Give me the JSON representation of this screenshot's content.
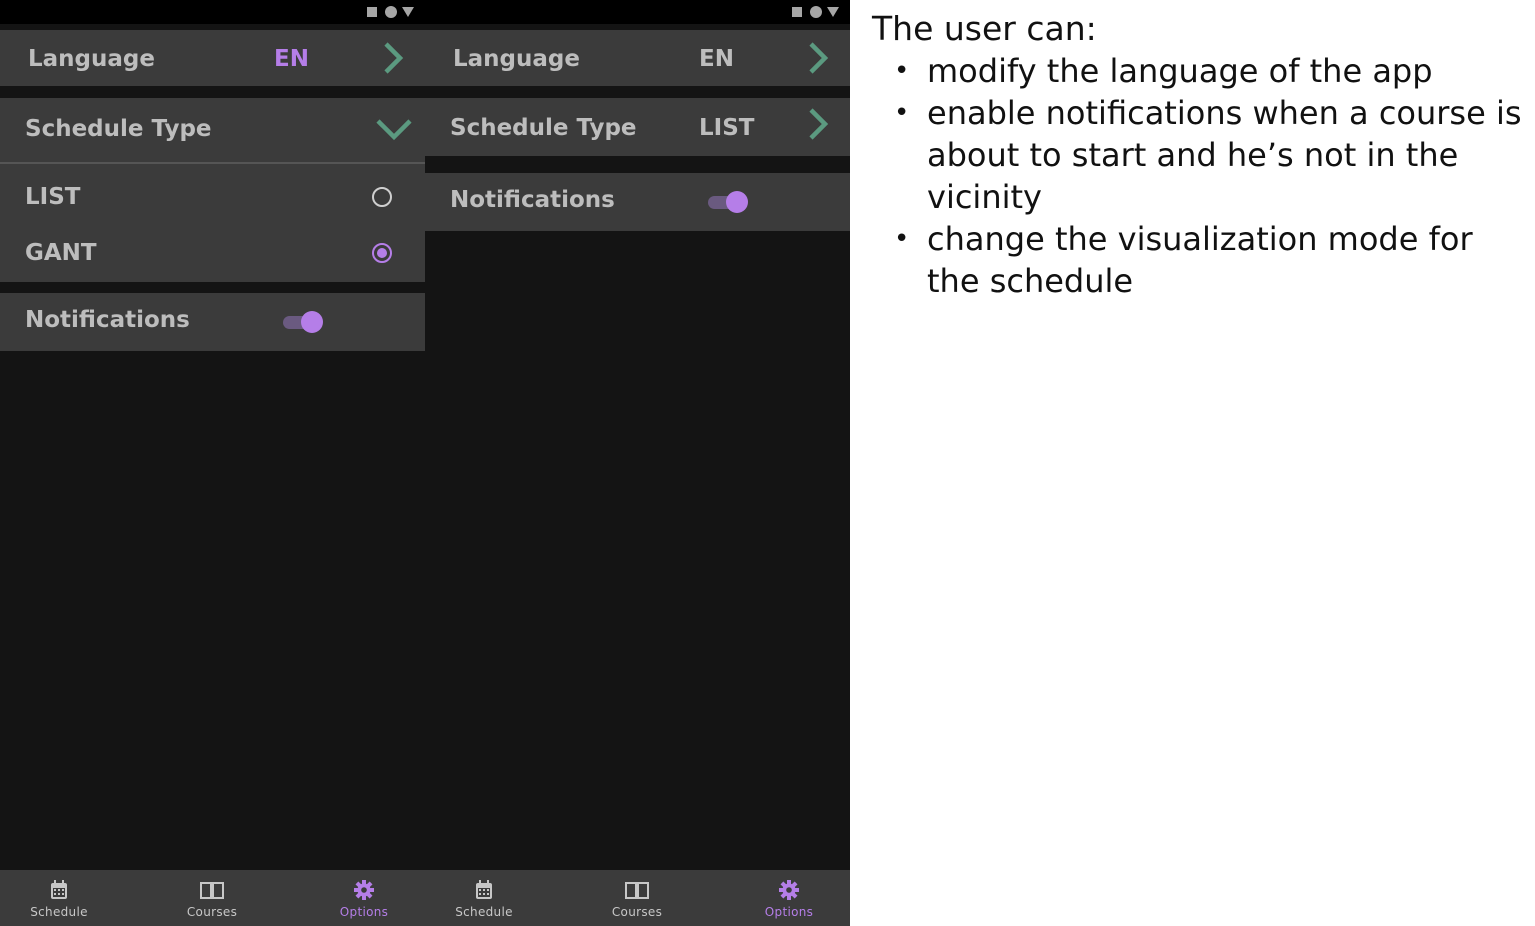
{
  "screen_left": {
    "language": {
      "label": "Language",
      "value": "EN"
    },
    "schedule_type": {
      "label": "Schedule Type",
      "options": [
        {
          "label": "LIST",
          "selected": false
        },
        {
          "label": "GANT",
          "selected": true
        }
      ]
    },
    "notifications": {
      "label": "Notifications",
      "enabled": true
    }
  },
  "screen_right": {
    "language": {
      "label": "Language",
      "value": "EN"
    },
    "schedule_type": {
      "label": "Schedule Type",
      "value": "LIST"
    },
    "notifications": {
      "label": "Notifications",
      "enabled": true
    }
  },
  "bottom_nav": {
    "items": [
      {
        "label": "Schedule",
        "icon": "calendar-icon"
      },
      {
        "label": "Courses",
        "icon": "book-icon"
      },
      {
        "label": "Options",
        "icon": "gear-icon",
        "active": true
      }
    ]
  },
  "description": {
    "title": "The user can:",
    "items": [
      "modify the language of the app",
      "enable notifications when a course is about to start and he’s not in the vicinity",
      "change the visualization mode for the schedule"
    ]
  },
  "colors": {
    "accent": "#b57ee8",
    "chevron": "#5b9a80",
    "row_background": "#3b3b3b",
    "screen_background": "#141414"
  }
}
